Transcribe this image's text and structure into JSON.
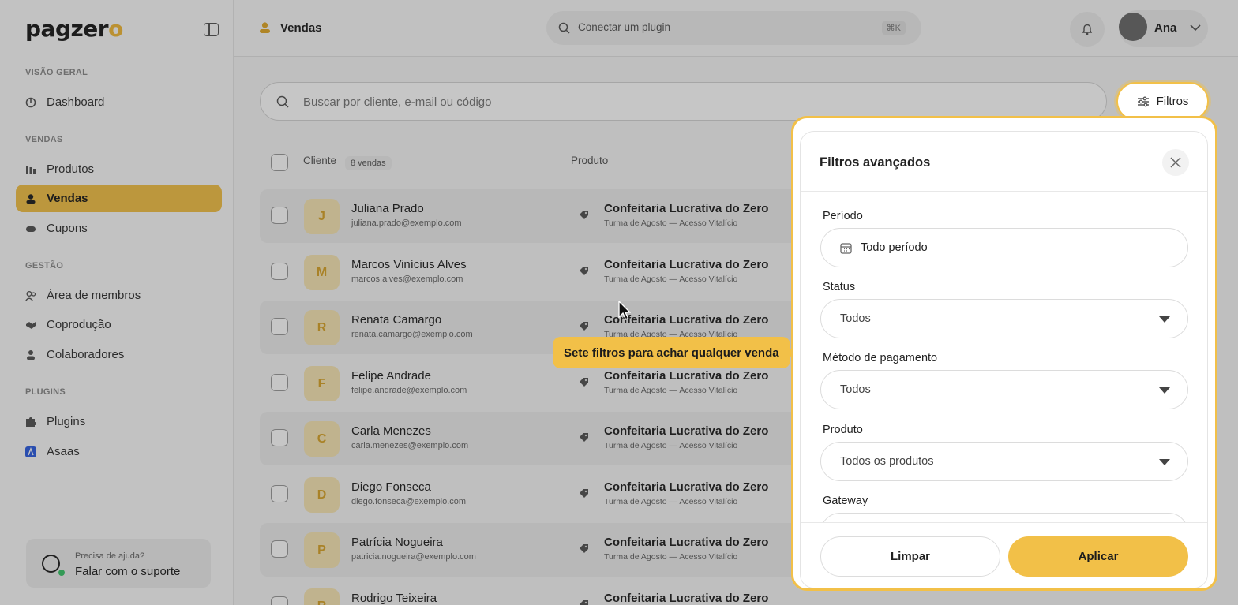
{
  "brand": {
    "name_main": "pagzer",
    "name_accent": "o",
    "accent_color": "#f2c048"
  },
  "sidebar": {
    "sections": [
      "VISÃO GERAL",
      "VENDAS",
      "GESTÃO",
      "PLUGINS"
    ],
    "items": [
      {
        "label": "Dashboard",
        "icon": "dashboard-icon"
      },
      {
        "label": "Produtos",
        "icon": "products-icon"
      },
      {
        "label": "Vendas",
        "icon": "sales-icon",
        "active": true
      },
      {
        "label": "Cupons",
        "icon": "coupon-icon"
      },
      {
        "label": "Área de membros",
        "icon": "members-icon"
      },
      {
        "label": "Coprodução",
        "icon": "handshake-icon"
      },
      {
        "label": "Colaboradores",
        "icon": "collaborators-icon"
      },
      {
        "label": "Plugins",
        "icon": "puzzle-icon"
      },
      {
        "label": "Asaas",
        "icon": "asaas-icon"
      }
    ],
    "help": {
      "caption": "Precisa de ajuda?",
      "link": "Falar com o suporte"
    }
  },
  "topbar": {
    "title": "Vendas",
    "command_placeholder": "Conectar um plugin",
    "command_shortcut": "⌘K",
    "user_name": "Ana"
  },
  "main": {
    "search_placeholder": "Buscar por cliente, e-mail ou código",
    "filters_label": "Filtros",
    "columns": {
      "client": "Cliente",
      "count_badge": "8 vendas",
      "product": "Produto"
    },
    "rows": [
      {
        "initial": "J",
        "name": "Juliana Prado",
        "email": "juliana.prado@exemplo.com",
        "product": "Confeitaria Lucrativa do Zero",
        "product_sub": "Turma de Agosto — Acesso Vitalício"
      },
      {
        "initial": "M",
        "name": "Marcos Vinícius Alves",
        "email": "marcos.alves@exemplo.com",
        "product": "Confeitaria Lucrativa do Zero",
        "product_sub": "Turma de Agosto — Acesso Vitalício"
      },
      {
        "initial": "R",
        "name": "Renata Camargo",
        "email": "renata.camargo@exemplo.com",
        "product": "Confeitaria Lucrativa do Zero",
        "product_sub": "Turma de Agosto — Acesso Vitalício"
      },
      {
        "initial": "F",
        "name": "Felipe Andrade",
        "email": "felipe.andrade@exemplo.com",
        "product": "Confeitaria Lucrativa do Zero",
        "product_sub": "Turma de Agosto — Acesso Vitalício"
      },
      {
        "initial": "C",
        "name": "Carla Menezes",
        "email": "carla.menezes@exemplo.com",
        "product": "Confeitaria Lucrativa do Zero",
        "product_sub": "Turma de Agosto — Acesso Vitalício"
      },
      {
        "initial": "D",
        "name": "Diego Fonseca",
        "email": "diego.fonseca@exemplo.com",
        "product": "Confeitaria Lucrativa do Zero",
        "product_sub": "Turma de Agosto — Acesso Vitalício"
      },
      {
        "initial": "P",
        "name": "Patrícia Nogueira",
        "email": "patricia.nogueira@exemplo.com",
        "product": "Confeitaria Lucrativa do Zero",
        "product_sub": "Turma de Agosto — Acesso Vitalício"
      },
      {
        "initial": "R",
        "name": "Rodrigo Teixeira",
        "email": "",
        "product": "Confeitaria Lucrativa do Zero",
        "product_sub": ""
      }
    ]
  },
  "tooltip": {
    "text": "Sete filtros para achar qualquer venda"
  },
  "filters_panel": {
    "title": "Filtros avançados",
    "fields": [
      {
        "label": "Período",
        "value": "Todo período"
      },
      {
        "label": "Status",
        "value": "Todos"
      },
      {
        "label": "Método de pagamento",
        "value": "Todos"
      },
      {
        "label": "Produto",
        "value": "Todos os produtos"
      },
      {
        "label": "Gateway",
        "value": ""
      }
    ],
    "clear_label": "Limpar",
    "apply_label": "Aplicar"
  }
}
